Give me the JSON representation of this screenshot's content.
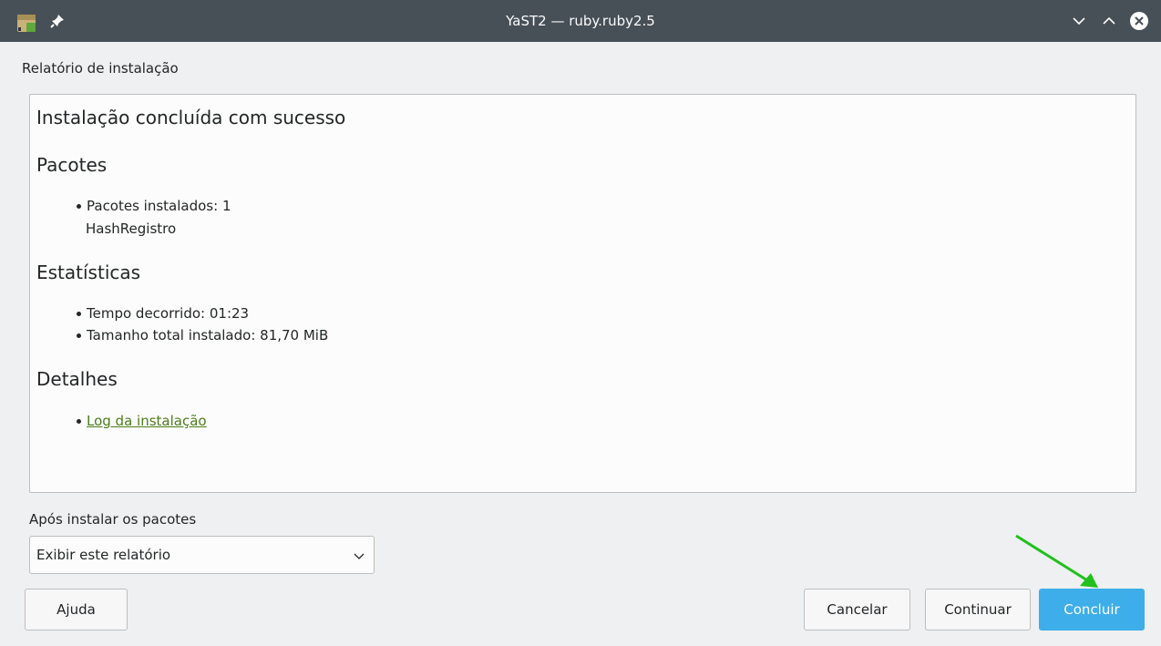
{
  "window": {
    "title": "YaST2 — ruby.ruby2.5",
    "icons": [
      "yast-app-icon",
      "pin-icon",
      "minimize-icon",
      "maximize-icon",
      "close-icon"
    ]
  },
  "report": {
    "section_label": "Relatório de instalação",
    "heading": "Instalação concluída com sucesso",
    "packages": {
      "heading": "Pacotes",
      "installed_label": "Pacotes instalados: 1",
      "installed_package": "HashRegistro"
    },
    "statistics": {
      "heading": "Estatísticas",
      "elapsed_time": "Tempo decorrido: 01:23",
      "total_size": "Tamanho total instalado: 81,70 MiB"
    },
    "details": {
      "heading": "Detalhes",
      "log_link": "Log da instalação"
    }
  },
  "after_install": {
    "label": "Após instalar os pacotes",
    "selected_option": "Exibir este relatório"
  },
  "buttons": {
    "help": "Ajuda",
    "cancel": "Cancelar",
    "continue": "Continuar",
    "finish": "Concluir"
  },
  "colors": {
    "titlebar": "#475057",
    "background": "#eff0f1",
    "accent": "#3daee9",
    "link": "#4c7d1a",
    "annotation_arrow": "#22c01c"
  }
}
